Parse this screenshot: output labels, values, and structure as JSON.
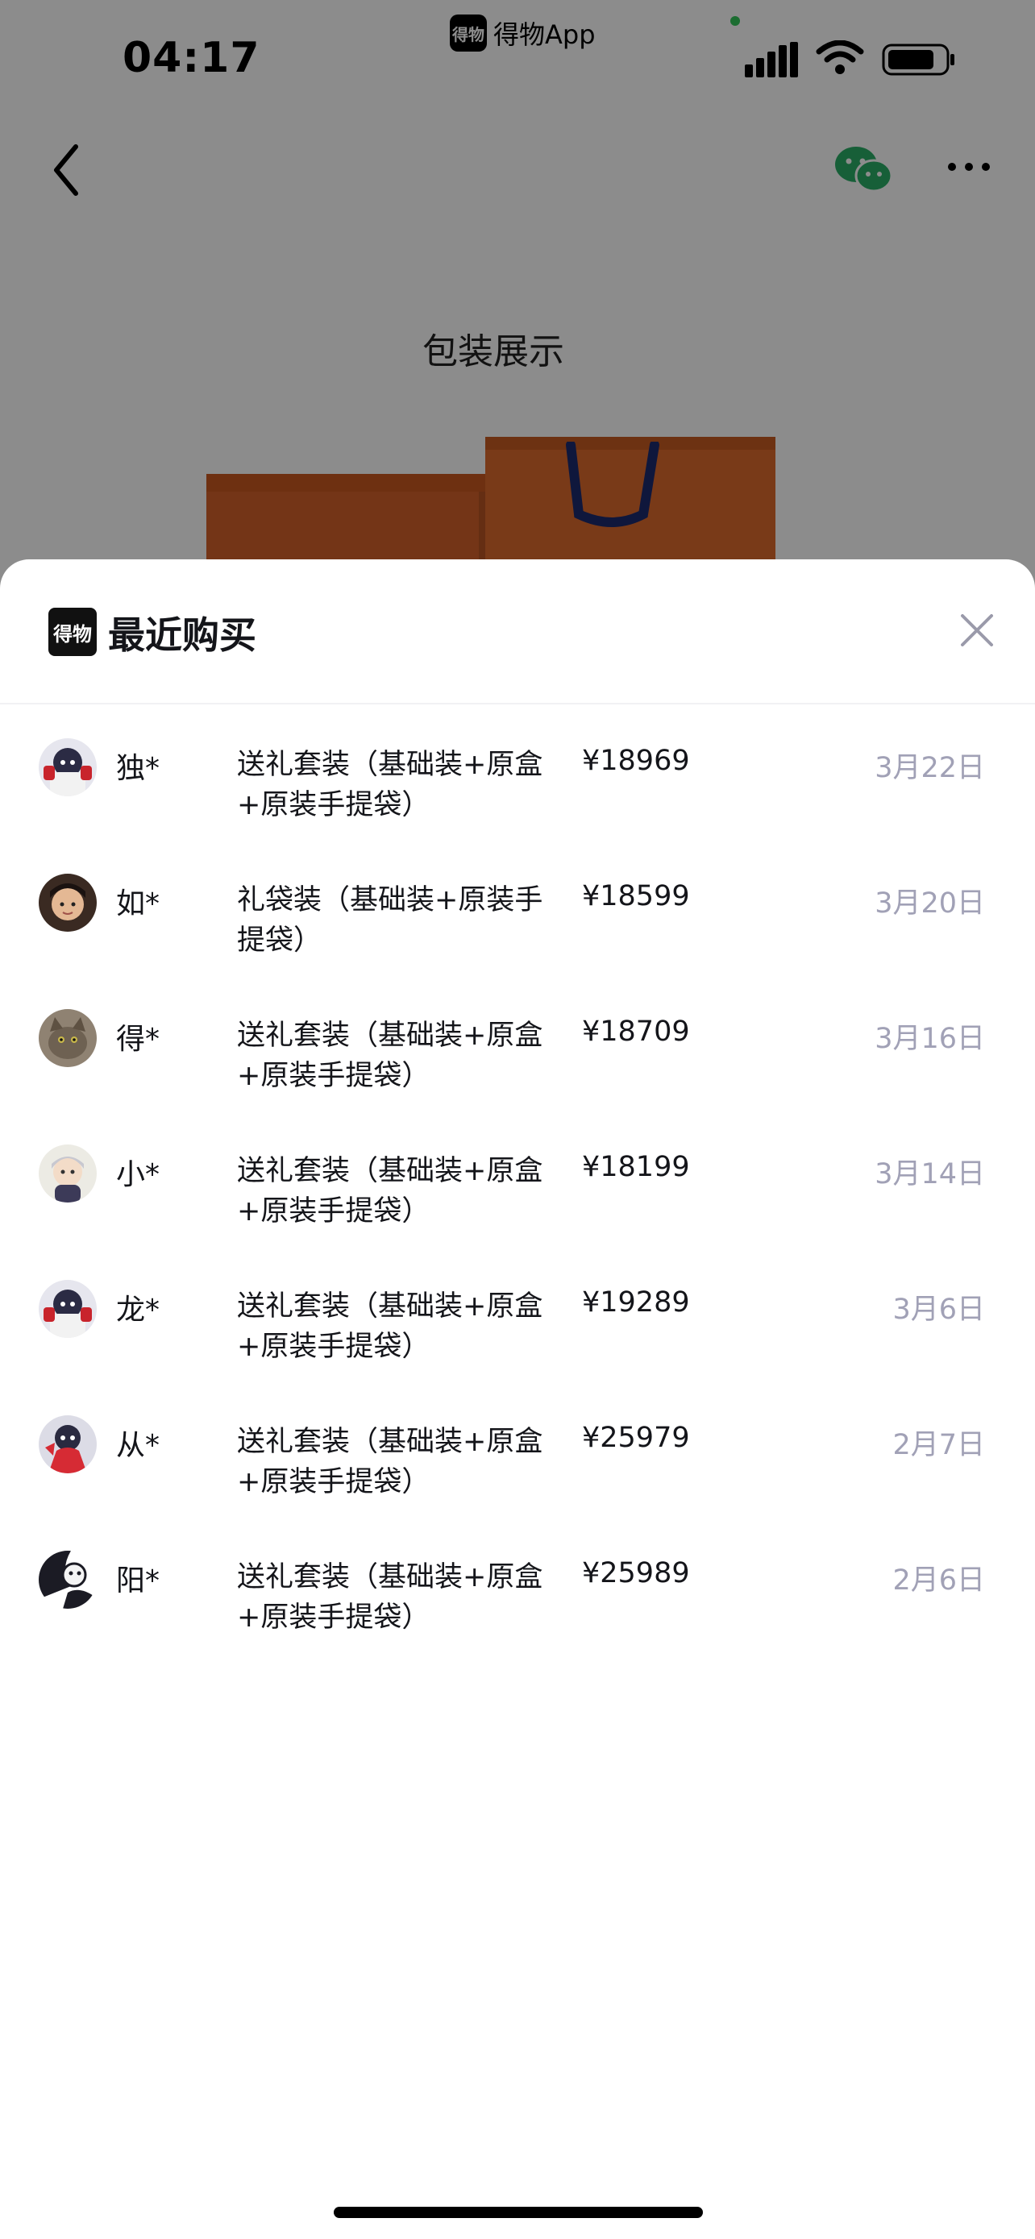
{
  "status_bar": {
    "time": "04:17",
    "app_badge_icon": "得物",
    "app_badge": "得物App"
  },
  "page": {
    "section_title": "包装展示"
  },
  "sheet": {
    "logo_text": "得物",
    "title": "最近购买",
    "close_icon": "close-icon",
    "rows": [
      {
        "name": "独*",
        "desc": "送礼套装（基础装+原盒+原装手提袋）",
        "price": "¥18969",
        "date": "3月22日",
        "avatar": "avatar-astronaut"
      },
      {
        "name": "如*",
        "desc": "礼袋装（基础装+原装手提袋）",
        "price": "¥18599",
        "date": "3月20日",
        "avatar": "avatar-person"
      },
      {
        "name": "得*",
        "desc": "送礼套装（基础装+原盒+原装手提袋）",
        "price": "¥18709",
        "date": "3月16日",
        "avatar": "avatar-cat"
      },
      {
        "name": "小*",
        "desc": "送礼套装（基础装+原盒+原装手提袋）",
        "price": "¥18199",
        "date": "3月14日",
        "avatar": "avatar-anime"
      },
      {
        "name": "龙*",
        "desc": "送礼套装（基础装+原盒+原装手提袋）",
        "price": "¥19289",
        "date": "3月6日",
        "avatar": "avatar-astronaut"
      },
      {
        "name": "从*",
        "desc": "送礼套装（基础装+原盒+原装手提袋）",
        "price": "¥25979",
        "date": "2月7日",
        "avatar": "avatar-red-cartoon"
      },
      {
        "name": "阳*",
        "desc": "送礼套装（基础装+原盒+原装手提袋）",
        "price": "¥25989",
        "date": "2月6日",
        "avatar": "avatar-bw-cartoon"
      }
    ]
  },
  "colors": {
    "wechat_green": "#2aae67",
    "date_gray": "#a1a1b6",
    "text_dark": "#14151a",
    "box_orange": "#d4622a"
  }
}
